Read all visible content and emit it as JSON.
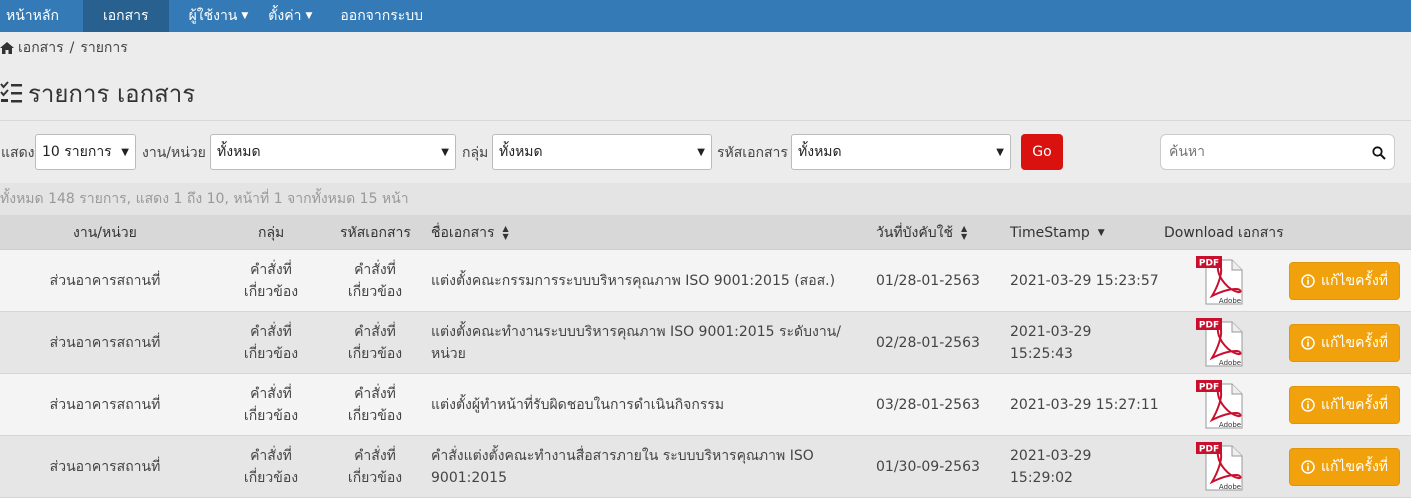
{
  "nav": {
    "items": [
      {
        "label": "หน้าหลัก"
      },
      {
        "label": "เอกสาร"
      },
      {
        "label": "ผู้ใช้งาน"
      },
      {
        "label": "ตั้งค่า"
      },
      {
        "label": "ออกจากระบบ"
      }
    ]
  },
  "breadcrumb": {
    "home": "เอกสาร",
    "current": "รายการ"
  },
  "page": {
    "title": "รายการ เอกสาร"
  },
  "filters": {
    "show_label": "แสดง",
    "show_value": "10 รายการ",
    "unit_label": "งาน/หน่วย",
    "unit_value": "ทั้งหมด",
    "group_label": "กลุ่ม",
    "group_value": "ทั้งหมด",
    "code_label": "รหัสเอกสาร",
    "code_value": "ทั้งหมด",
    "go_label": "Go",
    "search_placeholder": "ค้นหา"
  },
  "summary": "ทั้งหมด 148 รายการ, แสดง 1 ถึง 10, หน้าที่ 1 จากทั้งหมด 15 หน้า",
  "table": {
    "headers": {
      "unit": "งาน/หน่วย",
      "group": "กลุ่ม",
      "code": "รหัสเอกสาร",
      "name": "ชื่อเอกสาร",
      "effective": "วันที่บังคับใช้",
      "timestamp": "TimeStamp",
      "download": "Download เอกสาร"
    },
    "rows": [
      {
        "unit": "ส่วนอาคารสถานที่",
        "group_l1": "คำสั่งที่",
        "group_l2": "เกี่ยวข้อง",
        "code_l1": "คำสั่งที่",
        "code_l2": "เกี่ยวข้อง",
        "name_l1": "แต่งตั้งคณะกรรมการระบบบริหารคุณภาพ ISO 9001:2015 (สอส.)",
        "name_l2": "",
        "effective": "01/28-01-2563",
        "ts_l1": "2021-03-29 15:23:57",
        "ts_l2": "",
        "edit": "แก้ไขครั้งที่"
      },
      {
        "unit": "ส่วนอาคารสถานที่",
        "group_l1": "คำสั่งที่",
        "group_l2": "เกี่ยวข้อง",
        "code_l1": "คำสั่งที่",
        "code_l2": "เกี่ยวข้อง",
        "name_l1": "แต่งตั้งคณะทำงานระบบบริหารคุณภาพ ISO 9001:2015 ระดับงาน/",
        "name_l2": "หน่วย",
        "effective": "02/28-01-2563",
        "ts_l1": "2021-03-29",
        "ts_l2": "15:25:43",
        "edit": "แก้ไขครั้งที่"
      },
      {
        "unit": "ส่วนอาคารสถานที่",
        "group_l1": "คำสั่งที่",
        "group_l2": "เกี่ยวข้อง",
        "code_l1": "คำสั่งที่",
        "code_l2": "เกี่ยวข้อง",
        "name_l1": "แต่งตั้งผู้ทำหน้าที่รับผิดชอบในการดำเนินกิจกรรม",
        "name_l2": "",
        "effective": "03/28-01-2563",
        "ts_l1": "2021-03-29 15:27:11",
        "ts_l2": "",
        "edit": "แก้ไขครั้งที่"
      },
      {
        "unit": "ส่วนอาคารสถานที่",
        "group_l1": "คำสั่งที่",
        "group_l2": "เกี่ยวข้อง",
        "code_l1": "คำสั่งที่",
        "code_l2": "เกี่ยวข้อง",
        "name_l1": "คำสั่งแต่งตั้งคณะทำงานสื่อสารภายใน ระบบบริหารคุณภาพ ISO",
        "name_l2": "9001:2015",
        "effective": "01/30-09-2563",
        "ts_l1": "2021-03-29",
        "ts_l2": "15:29:02",
        "edit": "แก้ไขครั้งที่"
      }
    ]
  },
  "pdf_icon": {
    "badge": "PDF",
    "brand": "Adobe"
  },
  "colors": {
    "navbar": "#337ab7",
    "go": "#d9120f",
    "edit": "#f0a10b"
  }
}
